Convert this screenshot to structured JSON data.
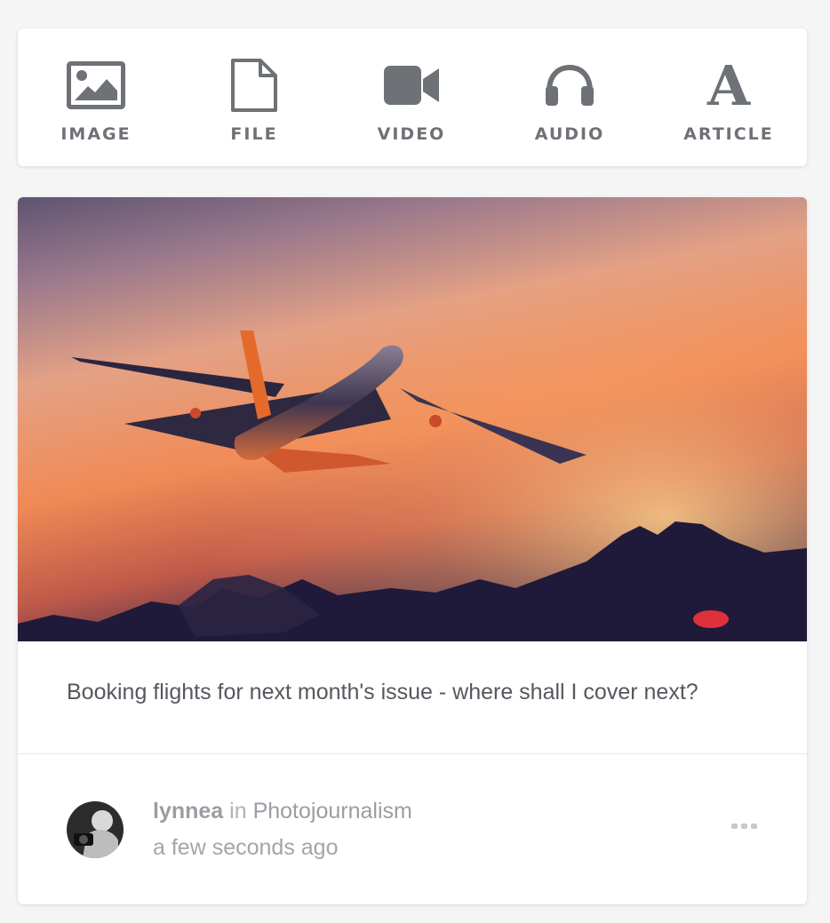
{
  "composer": {
    "items": [
      {
        "label": "IMAGE",
        "icon": "image-icon"
      },
      {
        "label": "FILE",
        "icon": "file-icon"
      },
      {
        "label": "VIDEO",
        "icon": "video-camera-icon"
      },
      {
        "label": "AUDIO",
        "icon": "headphones-icon"
      },
      {
        "label": "ARTICLE",
        "icon": "article-icon",
        "glyph": "A"
      }
    ],
    "icon_color": "#6e7175"
  },
  "post": {
    "image": {
      "subject": "airplane-sunset-photo"
    },
    "caption": "Booking flights for next month's issue - where shall I cover next?",
    "author": "lynnea",
    "in_word": "in",
    "community": "Photojournalism",
    "timestamp": "a few seconds ago",
    "more_icon": "more-dots-icon"
  },
  "colors": {
    "background": "#f5f5f5",
    "card": "#ffffff",
    "text": "#55595e",
    "muted": "#a2a5aa"
  }
}
